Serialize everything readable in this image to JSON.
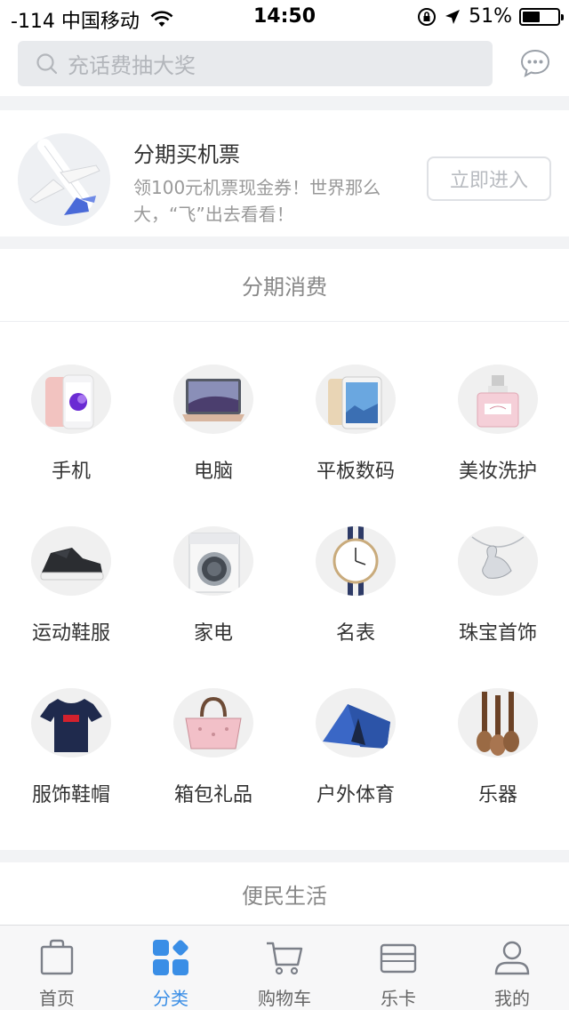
{
  "status_bar": {
    "carrier": "-114 中国移动",
    "time": "14:50",
    "battery": "51%",
    "battery_level": 0.51
  },
  "search": {
    "placeholder": "充话费抽大奖"
  },
  "banner": {
    "title": "分期买机票",
    "subtitle": "领100元机票现金券！世界那么大，“飞”出去看看！",
    "button": "立即进入"
  },
  "sections": {
    "installment": "分期消费",
    "living": "便民生活"
  },
  "categories": [
    {
      "label": "手机",
      "icon": "phone-icon"
    },
    {
      "label": "电脑",
      "icon": "laptop-icon"
    },
    {
      "label": "平板数码",
      "icon": "tablet-icon"
    },
    {
      "label": "美妆洗护",
      "icon": "perfume-icon"
    },
    {
      "label": "运动鞋服",
      "icon": "sneaker-icon"
    },
    {
      "label": "家电",
      "icon": "washing-machine-icon"
    },
    {
      "label": "名表",
      "icon": "watch-icon"
    },
    {
      "label": "珠宝首饰",
      "icon": "necklace-icon"
    },
    {
      "label": "服饰鞋帽",
      "icon": "tshirt-icon"
    },
    {
      "label": "箱包礼品",
      "icon": "handbag-icon"
    },
    {
      "label": "户外体育",
      "icon": "tent-icon"
    },
    {
      "label": "乐器",
      "icon": "ukulele-icon"
    }
  ],
  "tabs": [
    {
      "label": "首页",
      "icon": "shopping-bag-icon",
      "active": false
    },
    {
      "label": "分类",
      "icon": "category-grid-icon",
      "active": true
    },
    {
      "label": "购物车",
      "icon": "cart-icon",
      "active": false
    },
    {
      "label": "乐卡",
      "icon": "card-icon",
      "active": false
    },
    {
      "label": "我的",
      "icon": "user-icon",
      "active": false
    }
  ],
  "colors": {
    "accent": "#3a8ee6",
    "tab_inactive": "#666666",
    "background": "#f2f3f5"
  }
}
